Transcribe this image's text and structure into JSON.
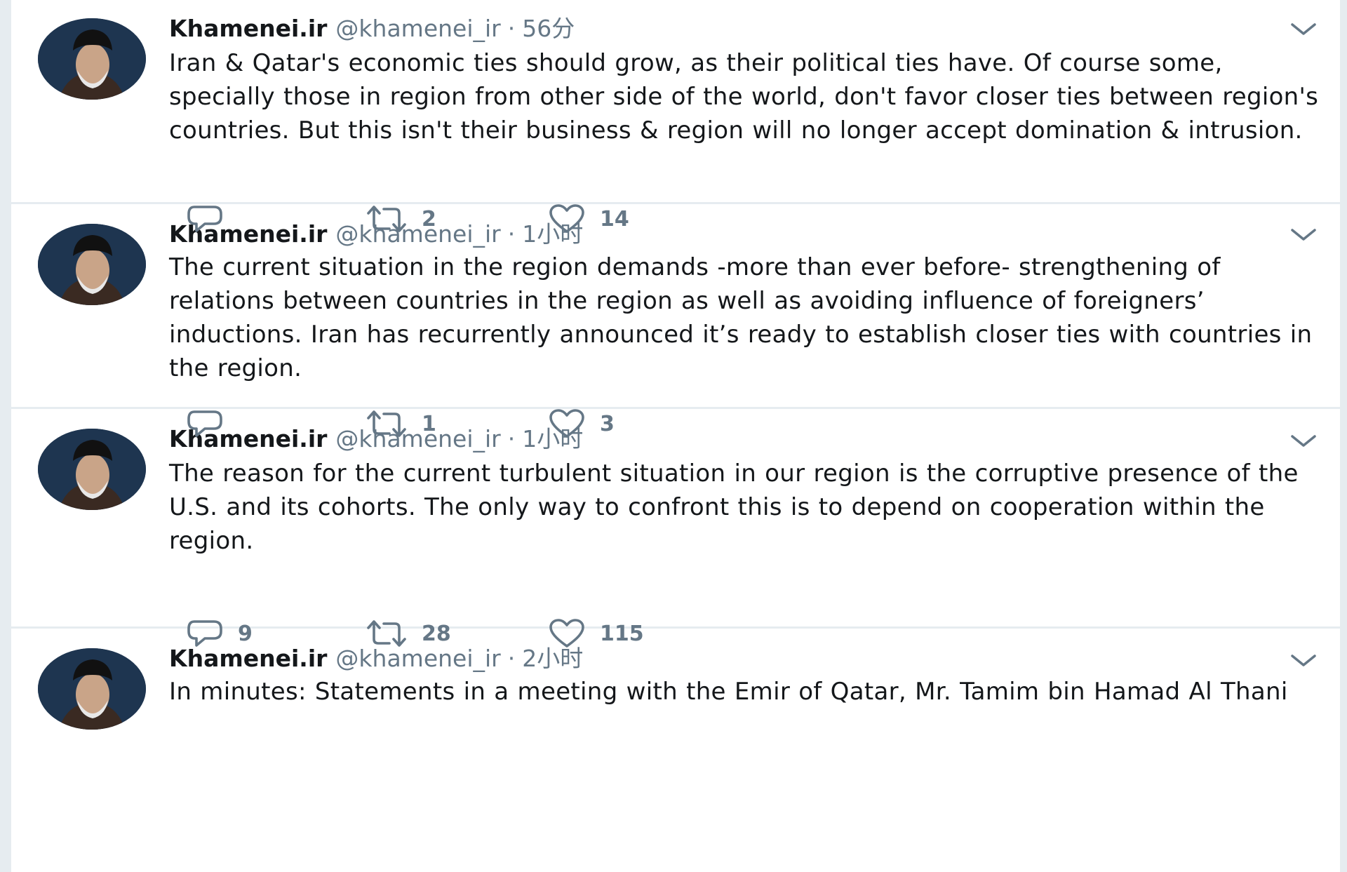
{
  "tweets": [
    {
      "name": "Khamenei.ir",
      "handle": "@khamenei_ir",
      "separator": "·",
      "time": "56分",
      "text": "Iran & Qatar's economic ties should grow, as their political ties have. Of course some, specially those in region from other side of the world, don't favor closer ties between region's countries. But this isn't their business & region will no longer accept domination & intrusion.",
      "replies": "",
      "retweets": "2",
      "likes": "14"
    },
    {
      "name": "Khamenei.ir",
      "handle": "@khamenei_ir",
      "separator": "·",
      "time": "1小时",
      "text": "The current situation in the region demands -more than ever before- strengthening of relations between countries in the region as well as avoiding influence of foreigners’ inductions. Iran has recurrently announced it’s ready to establish closer ties with countries in the region.",
      "replies": "",
      "retweets": "1",
      "likes": "3"
    },
    {
      "name": "Khamenei.ir",
      "handle": "@khamenei_ir",
      "separator": "·",
      "time": "1小时",
      "text": "The reason for the current turbulent situation in our region is the corruptive presence of the U.S. and its cohorts. The only way to confront this is to depend on cooperation within the region.",
      "replies": "9",
      "retweets": "28",
      "likes": "115"
    },
    {
      "name": "Khamenei.ir",
      "handle": "@khamenei_ir",
      "separator": "·",
      "time": "2小时",
      "text": "In minutes: Statements in a meeting with the Emir of Qatar, Mr. Tamim bin Hamad Al Thani",
      "replies": "",
      "retweets": "",
      "likes": ""
    }
  ],
  "icons": {
    "reply": "reply-icon",
    "retweet": "retweet-icon",
    "like": "heart-icon",
    "caret": "chevron-down-icon",
    "avatar": "avatar"
  },
  "colors": {
    "text": "#14171a",
    "secondary": "#657786",
    "divider": "#e6ecf0",
    "background": "#ffffff"
  }
}
